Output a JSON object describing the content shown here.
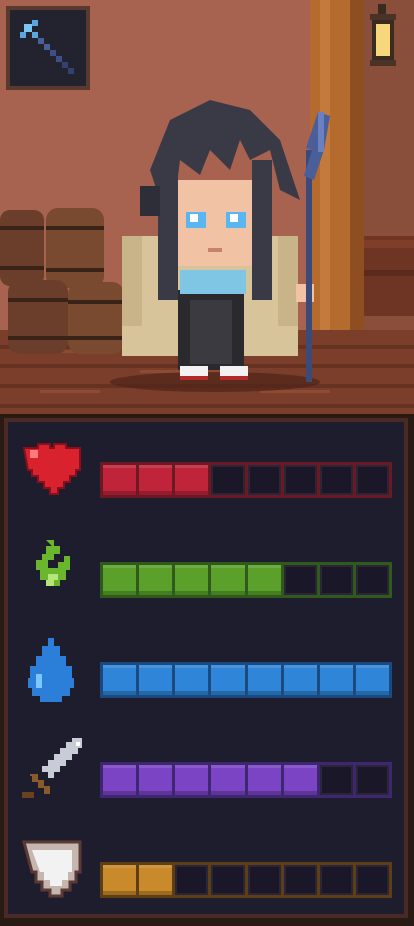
{
  "hud": {
    "equipped_weapon_icon": "magic-staff-icon"
  },
  "colors": {
    "panel_background": "#1e1d2e",
    "panel_border": "#4a2a24",
    "empty_segment": "#1a1828"
  },
  "stats": [
    {
      "name": "health",
      "icon": "heart-icon",
      "filled": 3,
      "total": 8,
      "color": "#c0243a",
      "frame": "#6b1a24"
    },
    {
      "name": "stamina",
      "icon": "flame-icon",
      "filled": 5,
      "total": 8,
      "color": "#5aa02a",
      "frame": "#2f5a1c"
    },
    {
      "name": "mana",
      "icon": "water-drop-icon",
      "filled": 8,
      "total": 8,
      "color": "#2f86d8",
      "frame": "#1b4a80"
    },
    {
      "name": "attack",
      "icon": "sword-icon",
      "filled": 6,
      "total": 8,
      "color": "#7a44c4",
      "frame": "#3e2670"
    },
    {
      "name": "defense",
      "icon": "shield-icon",
      "filled": 2,
      "total": 8,
      "color": "#c88a2a",
      "frame": "#5e3e14"
    }
  ]
}
